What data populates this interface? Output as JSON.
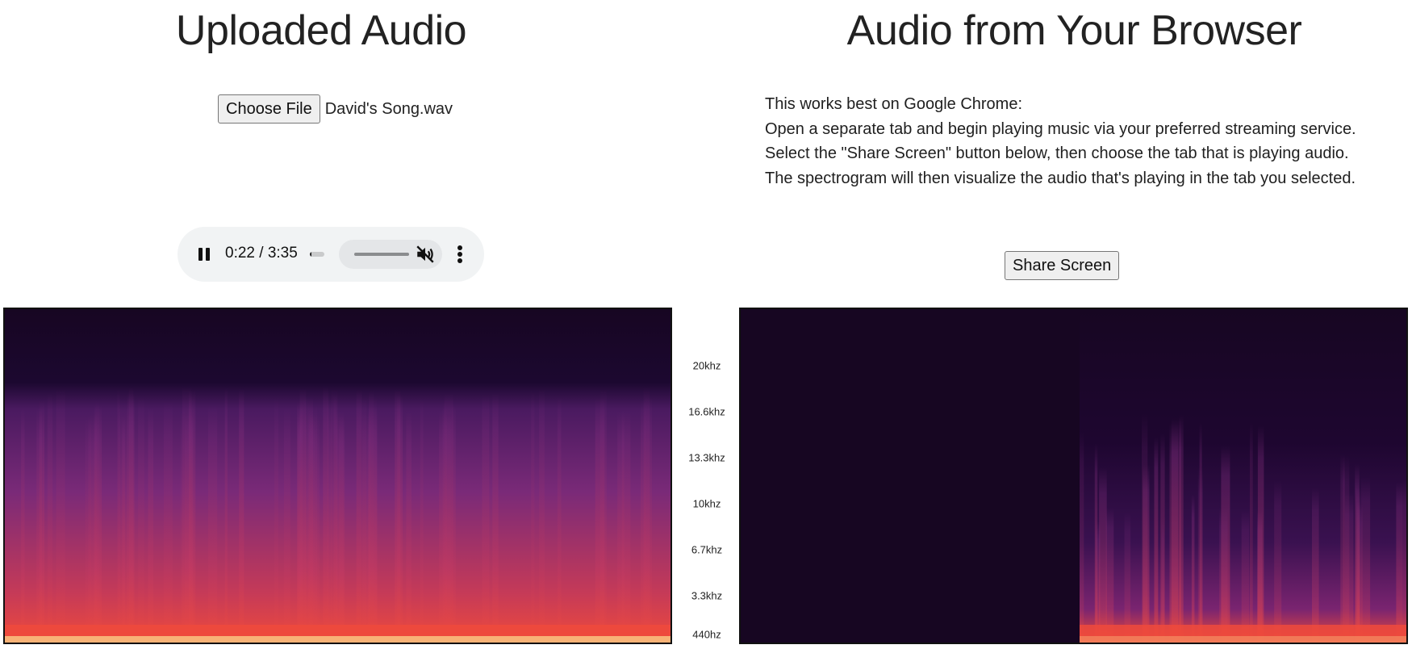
{
  "left_panel": {
    "title": "Uploaded Audio",
    "file_input": {
      "button_label": "Choose File",
      "filename": "David's Song.wav"
    },
    "player": {
      "state": "playing",
      "time_display": "0:22 / 3:35",
      "progress": 0.1,
      "volume": 1.0,
      "muted": true,
      "icons": [
        "pause-icon",
        "mute-icon",
        "more-vert-icon"
      ]
    }
  },
  "right_panel": {
    "title": "Audio from Your Browser",
    "instructions": [
      "This works best on Google Chrome:",
      "Open a separate tab and begin playing music via your preferred streaming service.",
      "Select the \"Share Screen\" button below, then choose the tab that is playing audio.",
      "The spectrogram will then visualize the audio that's playing in the tab you selected."
    ],
    "share_button": "Share Screen"
  },
  "frequency_axis": {
    "ticks": [
      "20khz",
      "16.6khz",
      "13.3khz",
      "10khz",
      "6.7khz",
      "3.3khz",
      "440hz"
    ]
  },
  "colors": {
    "spectrogram_background": "#170622",
    "spectrogram_mid": "#7a2a78",
    "spectrogram_high": "#ee4a3c",
    "spectrogram_peak": "#fbd58a",
    "player_background": "#f1f3f4"
  }
}
